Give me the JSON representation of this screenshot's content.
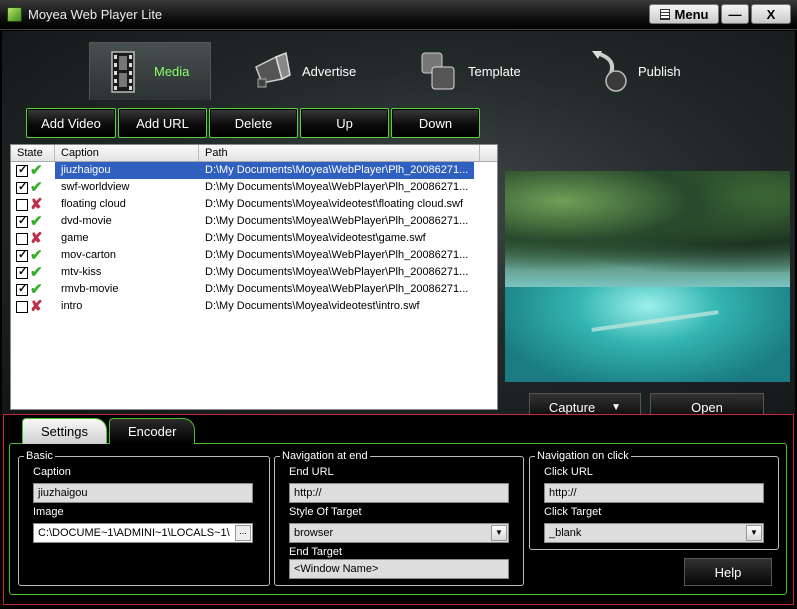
{
  "window": {
    "title": "Moyea Web Player Lite",
    "menu_label": "Menu",
    "minimize_glyph": "—",
    "close_glyph": "X"
  },
  "nav": {
    "tabs": [
      {
        "label": "Media",
        "icon": "film-icon",
        "active": true
      },
      {
        "label": "Advertise",
        "icon": "megaphone-icon",
        "active": false
      },
      {
        "label": "Template",
        "icon": "template-icon",
        "active": false
      },
      {
        "label": "Publish",
        "icon": "publish-icon",
        "active": false
      }
    ]
  },
  "toolbar": {
    "add_video": "Add Video",
    "add_url": "Add URL",
    "delete": "Delete",
    "up": "Up",
    "down": "Down"
  },
  "list": {
    "columns": [
      "State",
      "Caption",
      "Path"
    ],
    "rows": [
      {
        "checked": true,
        "ok": true,
        "caption": "jiuzhaigou",
        "path": "D:\\My Documents\\Moyea\\WebPlayer\\Plh_20086271...",
        "selected": true
      },
      {
        "checked": true,
        "ok": true,
        "caption": "swf-worldview",
        "path": "D:\\My Documents\\Moyea\\WebPlayer\\Plh_20086271..."
      },
      {
        "checked": false,
        "ok": false,
        "caption": "floating cloud",
        "path": "D:\\My Documents\\Moyea\\videotest\\floating cloud.swf"
      },
      {
        "checked": true,
        "ok": true,
        "caption": "dvd-movie",
        "path": "D:\\My Documents\\Moyea\\WebPlayer\\Plh_20086271..."
      },
      {
        "checked": false,
        "ok": false,
        "caption": "game",
        "path": "D:\\My Documents\\Moyea\\videotest\\game.swf"
      },
      {
        "checked": true,
        "ok": true,
        "caption": "mov-carton",
        "path": "D:\\My Documents\\Moyea\\WebPlayer\\Plh_20086271..."
      },
      {
        "checked": true,
        "ok": true,
        "caption": "mtv-kiss",
        "path": "D:\\My Documents\\Moyea\\WebPlayer\\Plh_20086271..."
      },
      {
        "checked": true,
        "ok": true,
        "caption": "rmvb-movie",
        "path": "D:\\My Documents\\Moyea\\WebPlayer\\Plh_20086271..."
      },
      {
        "checked": false,
        "ok": false,
        "caption": "intro",
        "path": "D:\\My Documents\\Moyea\\videotest\\intro.swf"
      }
    ]
  },
  "preview": {
    "capture_label": "Capture",
    "open_label": "Open"
  },
  "tabs": {
    "settings": "Settings",
    "encoder": "Encoder"
  },
  "basic": {
    "legend": "Basic",
    "caption_label": "Caption",
    "caption_value": "jiuzhaigou",
    "image_label": "Image",
    "image_value": "C:\\DOCUME~1\\ADMINI~1\\LOCALS~1\\",
    "browse_label": "..."
  },
  "nav_end": {
    "legend": "Navigation at end",
    "end_url_label": "End URL",
    "end_url_value": "http://",
    "style_label": "Style Of Target",
    "style_value": "browser",
    "end_target_label": "End Target",
    "end_target_value": "<Window Name>"
  },
  "nav_click": {
    "legend": "Navigation on click",
    "click_url_label": "Click URL",
    "click_url_value": "http://",
    "click_target_label": "Click Target",
    "click_target_value": "_blank"
  },
  "help_label": "Help"
}
